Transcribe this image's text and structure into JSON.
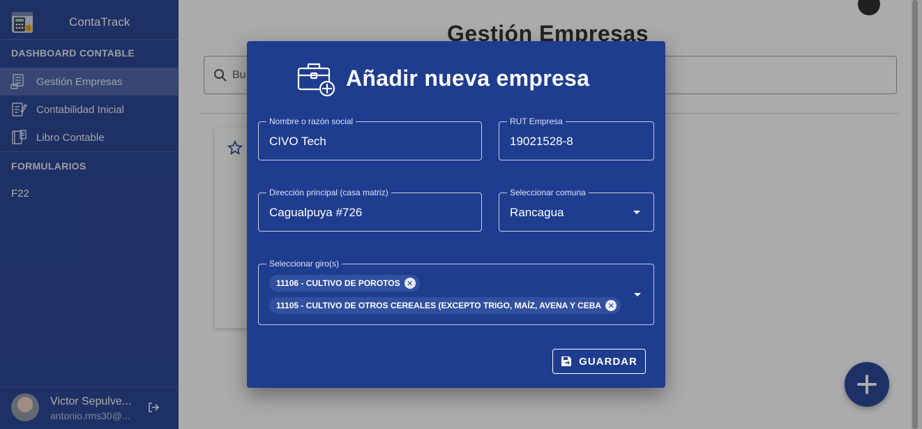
{
  "app": {
    "name": "ContaTrack"
  },
  "sidebar": {
    "sections": [
      {
        "title": "DASHBOARD CONTABLE"
      },
      {
        "title": "FORMULARIOS"
      }
    ],
    "items": [
      {
        "label": "Gestión Empresas",
        "icon": "building-list-icon",
        "active": true
      },
      {
        "label": "Contabilidad Inicial",
        "icon": "document-edit-icon",
        "active": false
      },
      {
        "label": "Libro Contable",
        "icon": "ledger-book-icon",
        "active": false
      }
    ],
    "forms": [
      {
        "label": "F22"
      }
    ],
    "user": {
      "name": "Victor Sepulve...",
      "email": "antonio.rms30@..."
    }
  },
  "main": {
    "title": "Gestión Empresas",
    "search_placeholder": "Bu",
    "fab_icon": "plus-icon"
  },
  "dialog": {
    "title": "Añadir nueva empresa",
    "icon": "briefcase-add-icon",
    "fields": {
      "nombre": {
        "label": "Nombre o razón social",
        "value": "CIVO Tech"
      },
      "rut": {
        "label": "RUT Empresa",
        "value": "19021528-8"
      },
      "direccion": {
        "label": "Dirección principal (casa matriz)",
        "value": "Cagualpuya #726"
      },
      "comuna": {
        "label": "Seleccionar comuna",
        "value": "Rancagua"
      },
      "giros": {
        "label": "Seleccionar giro(s)",
        "chips": [
          "11106 - CULTIVO DE POROTOS",
          "11105 - CULTIVO DE OTROS CEREALES (EXCEPTO TRIGO, MAÍZ, AVENA Y CEBA"
        ]
      }
    },
    "save_label": "GUARDAR"
  },
  "colors": {
    "primary": "#1c3a8f",
    "dialog": "#1f3d8f"
  }
}
